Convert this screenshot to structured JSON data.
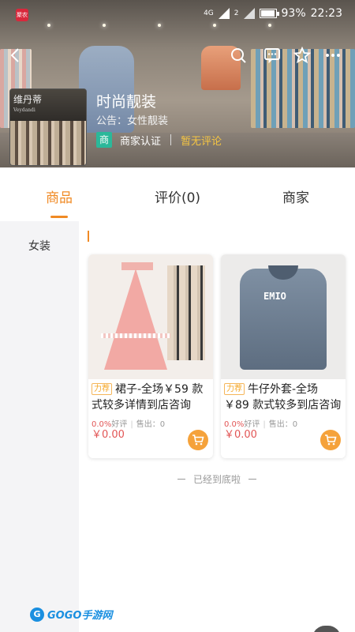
{
  "status_bar": {
    "app_badge": "聚农",
    "network": "4G",
    "sim2": "2",
    "battery": "93%",
    "time": "22:23"
  },
  "nav": {
    "back_icon": "back-arrow-icon",
    "search_icon": "search-icon",
    "message_icon": "message-icon",
    "favorite_icon": "star-icon",
    "more_icon": "more-icon"
  },
  "shop": {
    "thumb_sign": "维丹蒂",
    "thumb_sign_latin": "Veydandi",
    "name": "时尚靓装",
    "notice": "公告：女性靓装",
    "cert_badge": "商",
    "cert_text": "商家认证",
    "review_status": "暂无评论"
  },
  "tabs": [
    {
      "label": "商品",
      "active": true
    },
    {
      "label": "评价(0)",
      "active": false
    },
    {
      "label": "商家",
      "active": false
    }
  ],
  "sidebar": {
    "items": [
      {
        "label": "女装",
        "active": true
      }
    ]
  },
  "products": [
    {
      "tag": "力荐",
      "title": "裙子-全场￥59 款式较多详情到店咨询",
      "rating": "0.0%",
      "rating_label": "好评",
      "sold": "售出：0",
      "price": "￥0.00",
      "image_icon": "skirt-image"
    },
    {
      "tag": "力荐",
      "title": "牛仔外套-全场￥89 款式较多到店咨询",
      "rating": "0.0%",
      "rating_label": "好评",
      "sold": "售出：0",
      "price": "￥0.00",
      "image_icon": "jacket-image"
    }
  ],
  "end_note": "已经到底啦",
  "watermark": {
    "logo": "G",
    "text": "GOGO手游网"
  },
  "colors": {
    "accent": "#f08a24",
    "price": "#e25555",
    "cert": "#2bb89a",
    "review": "#f5c542"
  }
}
